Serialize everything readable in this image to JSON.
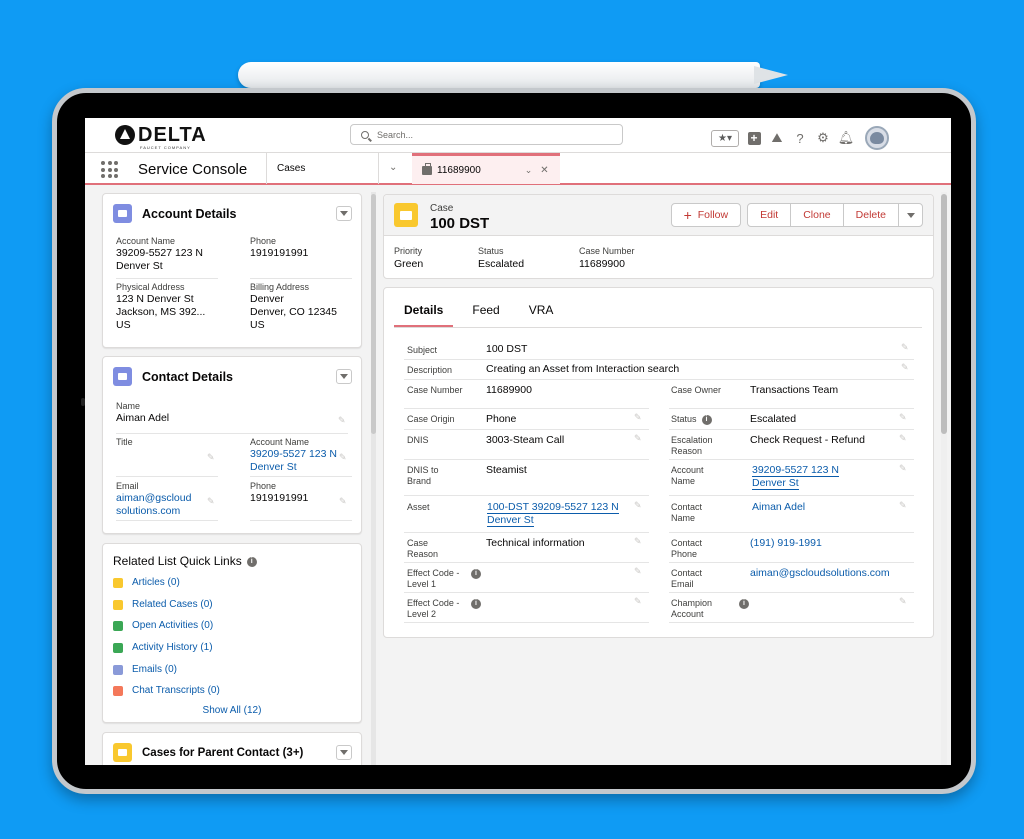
{
  "brand": {
    "name": "DELTA",
    "tagline": "FAUCET COMPANY"
  },
  "search": {
    "placeholder": "Search..."
  },
  "nav": {
    "app_name": "Service Console",
    "object_tab": "Cases",
    "record_tab": "11689900"
  },
  "account": {
    "title": "Account Details",
    "fields": [
      {
        "label": "Account Name",
        "value": "39209-5527 123 N Denver St"
      },
      {
        "label": "Phone",
        "value": "1919191991"
      },
      {
        "label": "Physical Address",
        "line1": "123 N Denver St",
        "line2": "Jackson, MS 392...",
        "line3": "US"
      },
      {
        "label": "Billing Address",
        "line1": "Denver",
        "line2": "Denver, CO 12345",
        "line3": "US"
      }
    ]
  },
  "contact": {
    "title": "Contact Details",
    "name_label": "Name",
    "name": "Aiman Adel",
    "title_label": "Title",
    "title_value": "",
    "account_label": "Account Name",
    "account": "39209-5527 123 N Denver St",
    "email_label": "Email",
    "email": "aiman@gscloud solutions.com",
    "phone_label": "Phone",
    "phone": "1919191991"
  },
  "related": {
    "title": "Related List Quick Links",
    "items": [
      {
        "label": "Articles (0)",
        "color": "#f9c82e"
      },
      {
        "label": "Related Cases (0)",
        "color": "#f9c82e"
      },
      {
        "label": "Open Activities (0)",
        "color": "#3ba755"
      },
      {
        "label": "Activity History (1)",
        "color": "#3ba755"
      },
      {
        "label": "Emails (0)",
        "color": "#8a9ad8"
      },
      {
        "label": "Chat Transcripts (0)",
        "color": "#f4785a"
      }
    ],
    "show_all": "Show All (12)"
  },
  "parent_cases": {
    "title": "Cases for Parent Contact (3+)"
  },
  "case": {
    "type": "Case",
    "name": "100 DST",
    "buttons": {
      "follow": "Follow",
      "edit": "Edit",
      "clone": "Clone",
      "delete": "Delete"
    },
    "highlights": [
      {
        "label": "Priority",
        "value": "Green"
      },
      {
        "label": "Status",
        "value": "Escalated"
      },
      {
        "label": "Case Number",
        "value": "11689900"
      }
    ]
  },
  "tabs": [
    "Details",
    "Feed",
    "VRA"
  ],
  "details": {
    "subject_label": "Subject",
    "subject": "100 DST",
    "description_label": "Description",
    "description": "Creating an Asset from Interaction search",
    "case_number_label": "Case Number",
    "case_number": "11689900",
    "case_owner_label": "Case Owner",
    "case_owner": "Transactions Team",
    "case_origin_label": "Case Origin",
    "case_origin": "Phone",
    "status_label": "Status",
    "status": "Escalated",
    "dnis_label": "DNIS",
    "dnis": "3003-Steam Call",
    "escalation_label": "Escalation Reason",
    "escalation": "Check Request - Refund",
    "dnis_brand_label": "DNIS to Brand",
    "dnis_brand": "Steamist",
    "account_name_label": "Account Name",
    "account_name": "39209-5527 123 N Denver St",
    "asset_label": "Asset",
    "asset": "100-DST 39209-5527 123 N Denver St",
    "contact_name_label": "Contact Name",
    "contact_name": "Aiman Adel",
    "case_reason_label": "Case Reason",
    "case_reason": "Technical information",
    "contact_phone_label": "Contact Phone",
    "contact_phone": "(191) 919-1991",
    "effect1_label": "Effect Code - Level 1",
    "effect1": "",
    "contact_email_label": "Contact Email",
    "contact_email": "aiman@gscloudsolutions.com",
    "effect2_label": "Effect Code - Level 2",
    "effect2": "",
    "champion_label": "Champion Account",
    "champion": ""
  }
}
